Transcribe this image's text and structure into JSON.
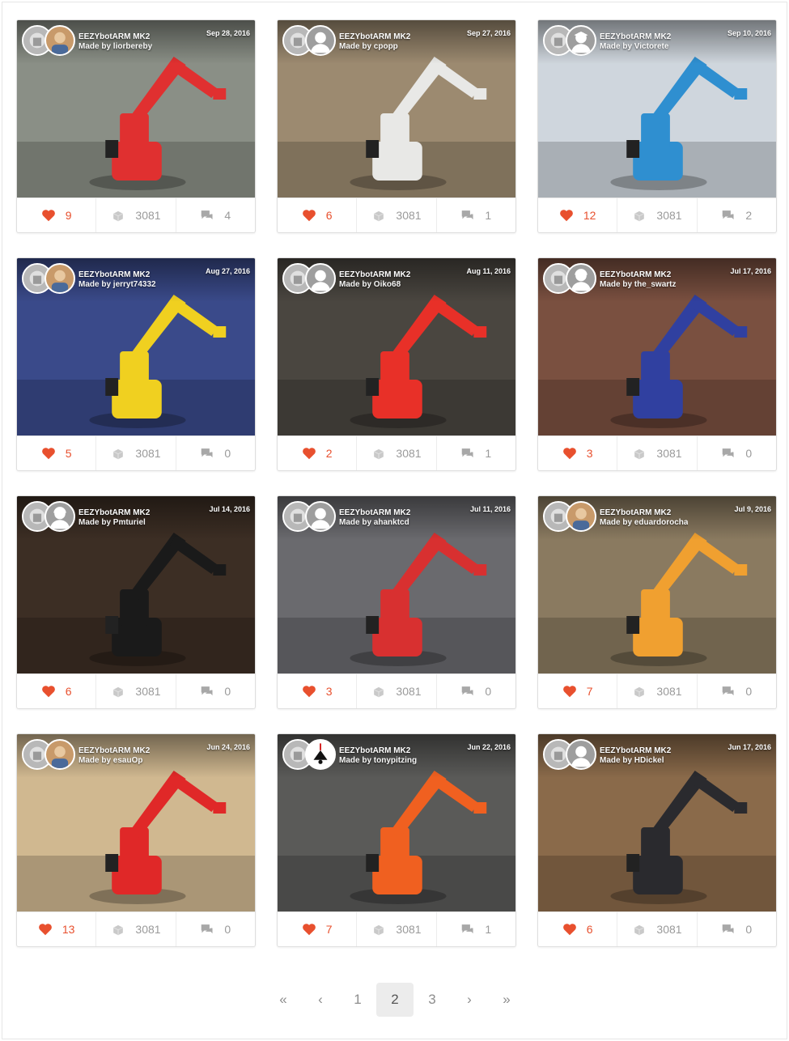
{
  "colors": {
    "accent": "#e8502e",
    "muted": "#9a9a9a"
  },
  "icons": {
    "like": "heart-icon",
    "remix": "cube-stack-icon",
    "comment": "comment-icon"
  },
  "cards": [
    {
      "title": "EEZYbotARM MK2",
      "made_by": "Made by liorbereby",
      "date": "Sep 28, 2016",
      "likes": "9",
      "things": "3081",
      "comments": "4",
      "bg": "#8a8f86",
      "arm": "#e03030",
      "avatar": "photo"
    },
    {
      "title": "EEZYbotARM MK2",
      "made_by": "Made by cpopp",
      "date": "Sep 27, 2016",
      "likes": "6",
      "things": "3081",
      "comments": "1",
      "bg": "#9c8a70",
      "arm": "#e8e8e6",
      "avatar": "default"
    },
    {
      "title": "EEZYbotARM MK2",
      "made_by": "Made by Victorete",
      "date": "Sep 10, 2016",
      "likes": "12",
      "things": "3081",
      "comments": "2",
      "bg": "#cfd6dd",
      "arm": "#2f8fd0",
      "avatar": "grad"
    },
    {
      "title": "EEZYbotARM MK2",
      "made_by": "Made by jerryt74332",
      "date": "Aug 27, 2016",
      "likes": "5",
      "things": "3081",
      "comments": "0",
      "bg": "#3a4a8a",
      "arm": "#f0d020",
      "avatar": "photo"
    },
    {
      "title": "EEZYbotARM MK2",
      "made_by": "Made by Oiko68",
      "date": "Aug 11, 2016",
      "likes": "2",
      "things": "3081",
      "comments": "1",
      "bg": "#4a4640",
      "arm": "#e83028",
      "avatar": "default"
    },
    {
      "title": "EEZYbotARM MK2",
      "made_by": "Made by the_swartz",
      "date": "Jul 17, 2016",
      "likes": "3",
      "things": "3081",
      "comments": "0",
      "bg": "#7a5040",
      "arm": "#3040a0",
      "avatar": "hard"
    },
    {
      "title": "EEZYbotARM MK2",
      "made_by": "Made by Pmturiel",
      "date": "Jul 14, 2016",
      "likes": "6",
      "things": "3081",
      "comments": "0",
      "bg": "#3c2e24",
      "arm": "#1a1a1a",
      "avatar": "hard"
    },
    {
      "title": "EEZYbotARM MK2",
      "made_by": "Made by ahanktcd",
      "date": "Jul 11, 2016",
      "likes": "3",
      "things": "3081",
      "comments": "0",
      "bg": "#6a6a6e",
      "arm": "#d83030",
      "avatar": "default"
    },
    {
      "title": "EEZYbotARM MK2",
      "made_by": "Made by eduardorocha",
      "date": "Jul 9, 2016",
      "likes": "7",
      "things": "3081",
      "comments": "0",
      "bg": "#8a7a60",
      "arm": "#f0a030",
      "avatar": "photo"
    },
    {
      "title": "EEZYbotARM MK2",
      "made_by": "Made by esauOp",
      "date": "Jun 24, 2016",
      "likes": "13",
      "things": "3081",
      "comments": "0",
      "bg": "#d0b890",
      "arm": "#e02828",
      "avatar": "photo"
    },
    {
      "title": "EEZYbotARM MK2",
      "made_by": "Made by tonypitzing",
      "date": "Jun 22, 2016",
      "likes": "7",
      "things": "3081",
      "comments": "1",
      "bg": "#5a5a58",
      "arm": "#f06020",
      "avatar": "lamp"
    },
    {
      "title": "EEZYbotARM MK2",
      "made_by": "Made by HDickel",
      "date": "Jun 17, 2016",
      "likes": "6",
      "things": "3081",
      "comments": "0",
      "bg": "#8a6a4a",
      "arm": "#2a2a2e",
      "avatar": "default"
    }
  ],
  "pagination": {
    "first": "«",
    "prev": "‹",
    "pages": [
      "1",
      "2",
      "3"
    ],
    "current": "2",
    "next": "›",
    "last": "»"
  }
}
